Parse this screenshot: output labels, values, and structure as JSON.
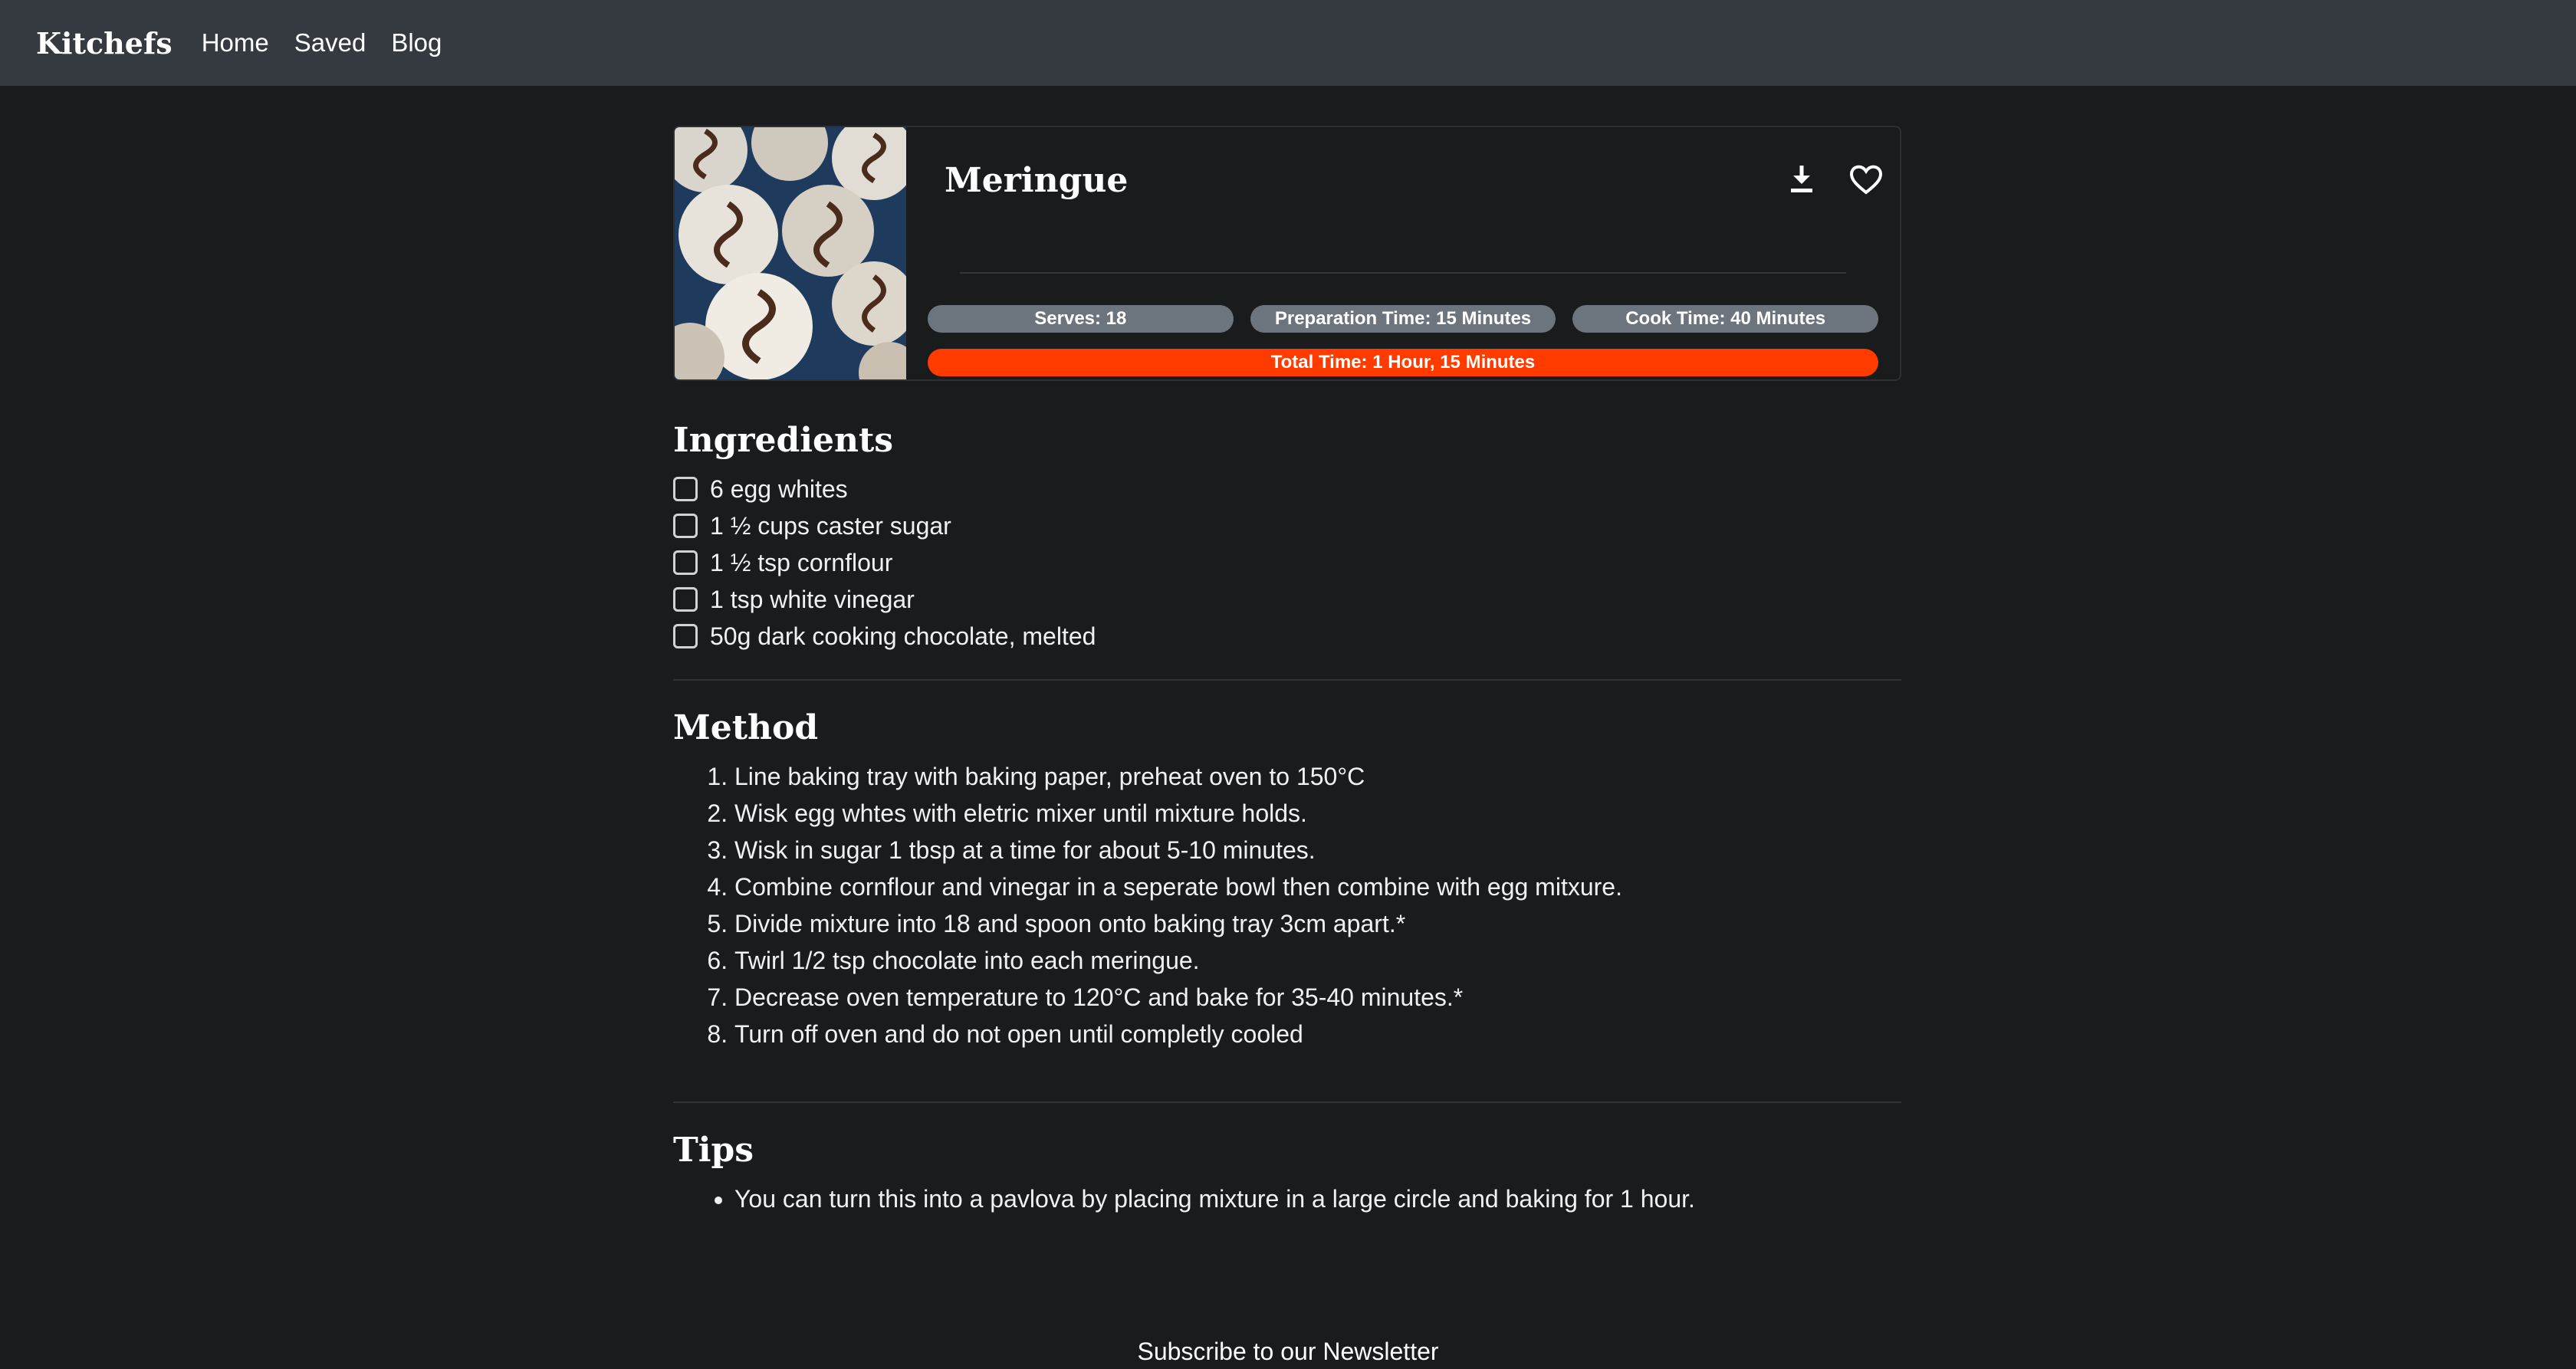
{
  "nav": {
    "brand": "Kitchefs",
    "links": [
      "Home",
      "Saved",
      "Blog"
    ]
  },
  "recipe": {
    "title": "Meringue",
    "image_icon": "meringue-photo",
    "serves": "Serves: 18",
    "prep_time": "Preparation Time: 15 Minutes",
    "cook_time": "Cook Time: 40 Minutes",
    "total_time": "Total Time: 1 Hour, 15 Minutes",
    "actions": [
      "download-icon",
      "heart-icon"
    ]
  },
  "ingredients": {
    "title": "Ingredients",
    "items": [
      "6 egg whites",
      "1 ½ cups caster sugar",
      "1 ½ tsp cornflour",
      "1 tsp white vinegar",
      "50g dark cooking chocolate, melted"
    ]
  },
  "method": {
    "title": "Method",
    "steps": [
      "Line baking tray with baking paper, preheat oven to 150°C",
      "Wisk egg whtes with eletric mixer until mixture holds.",
      "Wisk in sugar 1 tbsp at a time for about 5-10 minutes.",
      "Combine cornflour and vinegar in a seperate bowl then combine with egg mitxure.",
      "Divide mixture into 18 and spoon onto baking tray 3cm apart.*",
      "Twirl 1/2 tsp chocolate into each meringue.",
      "Decrease oven temperature to 120°C and bake for 35-40 minutes.*",
      "Turn off oven and do not open until completly cooled"
    ]
  },
  "tips": {
    "title": "Tips",
    "items": [
      "You can turn this into a pavlova by placing mixture in a large circle and baking for 1 hour."
    ]
  },
  "footer": {
    "newsletter": "Subscribe to our Newsletter"
  },
  "colors": {
    "navbar": "#343a40",
    "background": "#191b1d",
    "badge": "#6c757d",
    "accent": "#ff3b00"
  }
}
